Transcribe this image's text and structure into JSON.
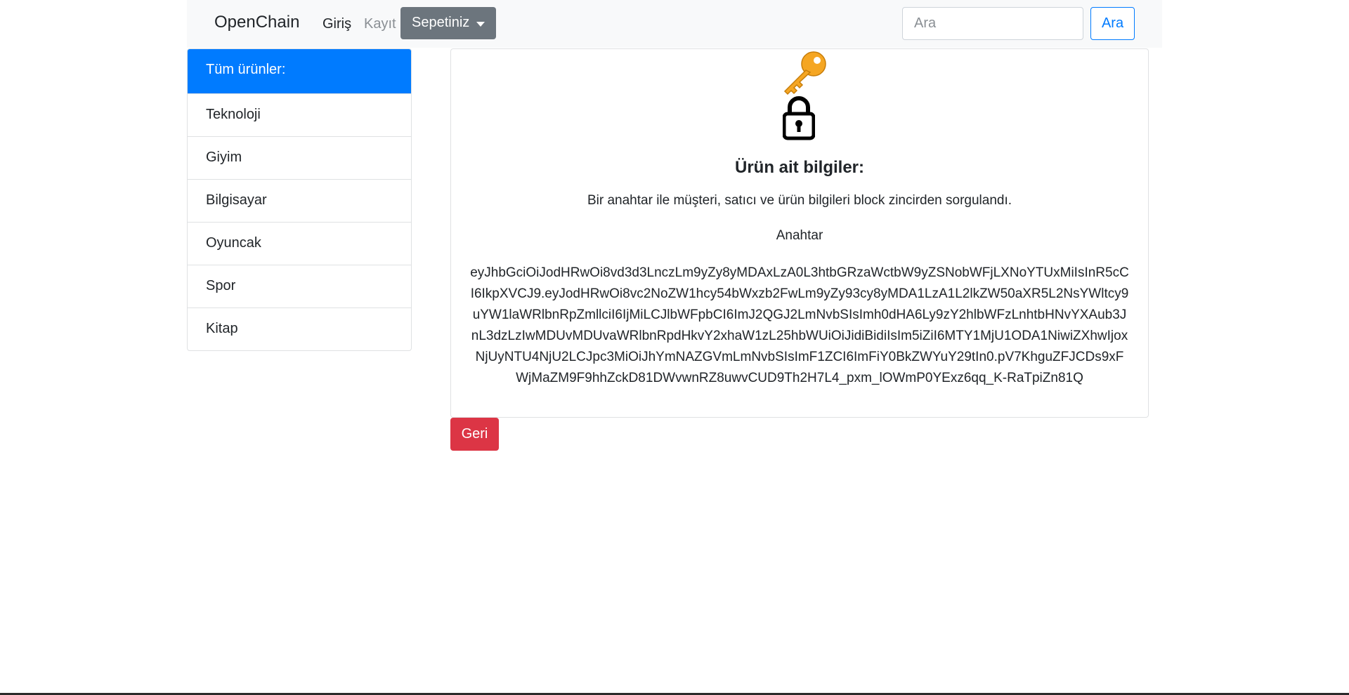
{
  "navbar": {
    "brand": "OpenChain",
    "login_label": "Giriş",
    "register_label": "Kayıt",
    "cart_label": "Sepetiniz",
    "search": {
      "placeholder": "Ara",
      "value": ""
    },
    "search_button_label": "Ara"
  },
  "sidebar": {
    "items": [
      {
        "label": "Tüm ürünler:",
        "active": true
      },
      {
        "label": "Teknoloji",
        "active": false
      },
      {
        "label": "Giyim",
        "active": false
      },
      {
        "label": "Bilgisayar",
        "active": false
      },
      {
        "label": "Oyuncak",
        "active": false
      },
      {
        "label": "Spor",
        "active": false
      },
      {
        "label": "Kitap",
        "active": false
      }
    ]
  },
  "card": {
    "icons": [
      "key-icon",
      "lock-icon"
    ],
    "title": "Ürün ait bilgiler:",
    "description": "Bir anahtar ile müşteri, satıcı ve ürün bilgileri block zincirden sorgulandı.",
    "key_label": "Anahtar",
    "key_value": "eyJhbGciOiJodHRwOi8vd3d3LnczLm9yZy8yMDAxLzA0L3htbGRzaWctbW9yZSNobWFjLXNoYTUxMiIsInR5cCI6IkpXVCJ9.eyJodHRwOi8vc2NoZW1hcy54bWxzb2FwLm9yZy93cy8yMDA1LzA1L2lkZW50aXR5L2NsYWltcy9uYW1laWRlbnRpZmllciI6IjMiLCJlbWFpbCI6ImJ2QGJ2LmNvbSIsImh0dHA6Ly9zY2hlbWFzLnhtbHNvYXAub3JnL3dzLzIwMDUvMDUvaWRlbnRpdHkvY2xhaW1zL25hbWUiOiJidiBidiIsIm5iZiI6MTY1MjU1ODA1NiwiZXhwIjoxNjUyNTU4NjU2LCJpc3MiOiJhYmNAZGVmLmNvbSIsImF1ZCI6ImFiY0BkZWYuY29tIn0.pV7KhguZFJCDs9xFWjMaZM9F9hhZckD81DWvwnRZ8uwvCUD9Th2H7L4_pxm_lOWmP0YExz6qq_K-RaTpiZn81Q"
  },
  "back_button_label": "Geri",
  "colors": {
    "primary": "#007bff",
    "secondary": "#6c757d",
    "danger": "#dc3545",
    "key_gold": "#f5a623",
    "navbar_bg": "#f8f9fa"
  }
}
